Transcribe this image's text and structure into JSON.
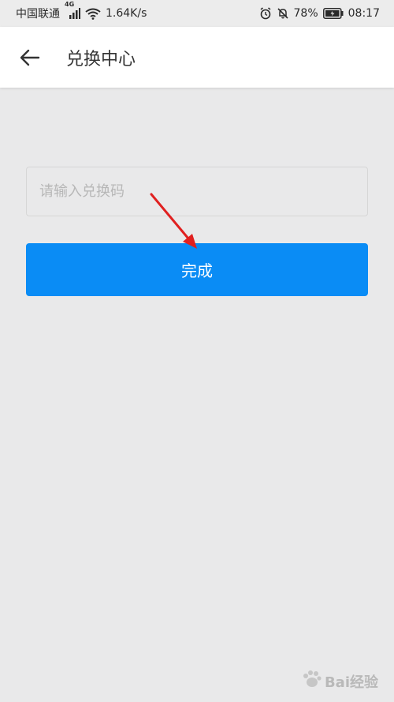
{
  "status_bar": {
    "carrier": "中国联通",
    "network": "4G",
    "speed": "1.64K/s",
    "battery": "78%",
    "time": "08:17"
  },
  "app_bar": {
    "title": "兑换中心"
  },
  "form": {
    "code_placeholder": "请输入兑换码",
    "submit_label": "完成"
  },
  "watermark": {
    "brand": "Bai经验"
  },
  "colors": {
    "primary": "#0a8cf5",
    "background": "#e9e9ea",
    "annotation": "#e02020"
  }
}
